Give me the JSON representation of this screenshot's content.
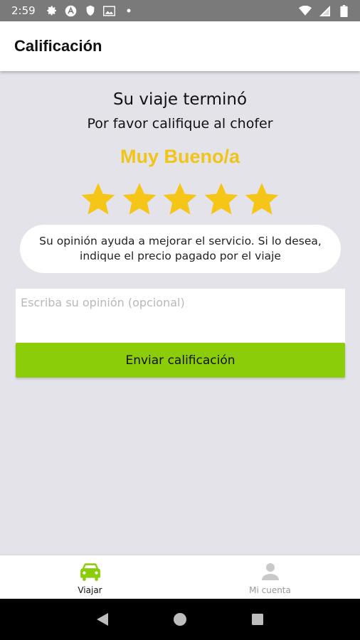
{
  "status_bar": {
    "time": "2:59",
    "left_icons": [
      "gear-icon",
      "app-a-icon",
      "shield-icon",
      "image-icon",
      "dot-icon"
    ],
    "right_icons": [
      "wifi-icon",
      "signal-icon",
      "battery-icon"
    ]
  },
  "header": {
    "title": "Calificación"
  },
  "main": {
    "trip_ended": "Su viaje terminó",
    "rate_prompt": "Por favor califique al chofer",
    "rating_label": "Muy Bueno/a",
    "rating": {
      "value": 5,
      "max": 5
    },
    "info_text": "Su opinión ayuda a mejorar el servicio. Si lo desea, indique el precio pagado por el viaje",
    "opinion_input": {
      "placeholder": "Escriba su opinión (opcional)",
      "value": ""
    },
    "submit_label": "Enviar calificación"
  },
  "bottom_nav": {
    "items": [
      {
        "label": "Viajar",
        "icon": "car-icon",
        "active": true
      },
      {
        "label": "Mi cuenta",
        "icon": "person-icon",
        "active": false
      }
    ]
  },
  "system_nav": {
    "buttons": [
      "back-icon",
      "home-icon",
      "recents-icon"
    ]
  },
  "colors": {
    "accent_star": "#f5c518",
    "rating_text": "#f0c419",
    "button_green": "#8ccd0a",
    "active_nav_icon": "#8ccd0a",
    "background": "#e4e3ea"
  }
}
